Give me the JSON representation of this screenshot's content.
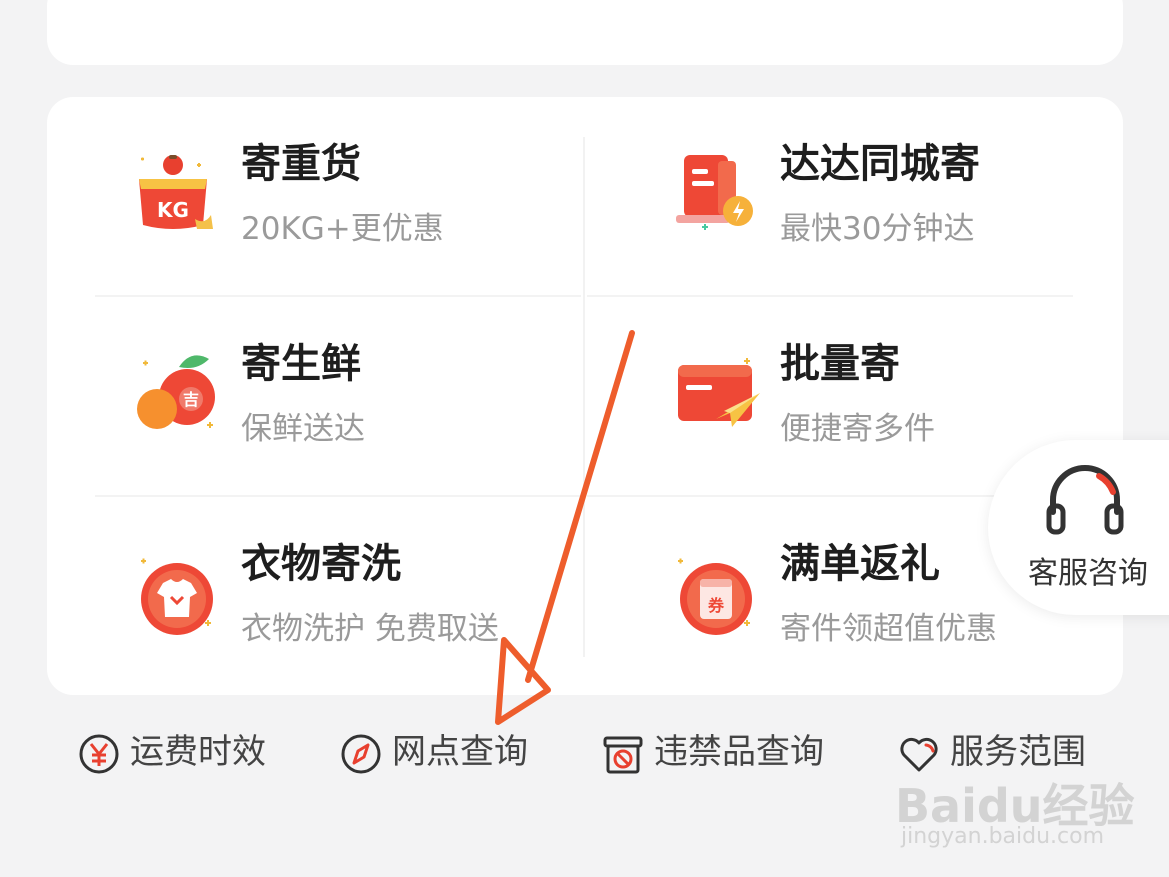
{
  "services": [
    {
      "title": "寄重货",
      "subtitle": "20KG+更优惠",
      "icon": "heavy-cargo-kg-icon"
    },
    {
      "title": "达达同城寄",
      "subtitle": "最快30分钟达",
      "icon": "same-city-delivery-icon"
    },
    {
      "title": "寄生鲜",
      "subtitle": "保鲜送达",
      "icon": "fresh-fruit-icon"
    },
    {
      "title": "批量寄",
      "subtitle": "便捷寄多件",
      "icon": "batch-send-icon"
    },
    {
      "title": "衣物寄洗",
      "subtitle": "衣物洗护 免费取送",
      "icon": "clothing-wash-icon"
    },
    {
      "title": "满单返礼",
      "subtitle": "寄件领超值优惠",
      "icon": "coupon-gift-icon"
    }
  ],
  "icon_texts": {
    "kg": "KG",
    "fruit": "吉",
    "coupon": "券"
  },
  "customer_service": {
    "label": "客服咨询",
    "icon": "headset-icon"
  },
  "quick_links": [
    {
      "label": "运费时效",
      "icon": "yen-circle-icon"
    },
    {
      "label": "网点查询",
      "icon": "compass-icon"
    },
    {
      "label": "违禁品查询",
      "icon": "prohibited-box-icon"
    },
    {
      "label": "服务范围",
      "icon": "heart-icon"
    }
  ],
  "watermark": {
    "brand": "Baidu经验",
    "url": "jingyan.baidu.com"
  },
  "colors": {
    "accent": "#e8402f",
    "arrow": "#ee5d2c",
    "title": "#1e1e1e",
    "subtitle": "#9a9a9a"
  }
}
